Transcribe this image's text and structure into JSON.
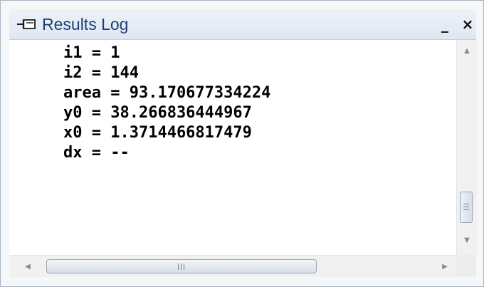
{
  "window": {
    "title": "Results Log",
    "icon": "pin-icon",
    "minimize_label": "_",
    "close_label": "×"
  },
  "log": {
    "lines": [
      "i1 = 1",
      "i2 = 144",
      "area = 93.170677334224",
      "y0 = 38.266836444967",
      "x0 = 1.3714466817479",
      "dx = --"
    ]
  },
  "scrollbars": {
    "vertical_position": 0.8,
    "horizontal_position": 0.0
  },
  "colors": {
    "title_text": "#1d3f77",
    "log_text": "#000000",
    "content_bg": "#ffffff"
  }
}
